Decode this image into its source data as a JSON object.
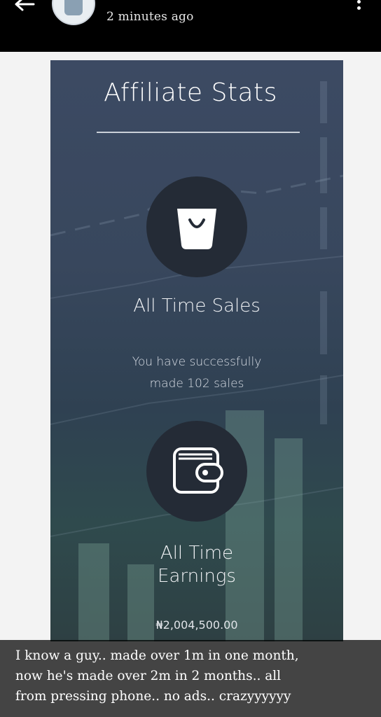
{
  "header": {
    "timestamp": "2 minutes ago",
    "icons": {
      "back": "back-arrow-icon",
      "menu": "more-vertical-icon"
    }
  },
  "card": {
    "title": "Affiliate Stats",
    "sales": {
      "icon": "shopping-bag-icon",
      "label": "All Time Sales",
      "description_line1": "You have successfully",
      "description_line2": "made 102 sales"
    },
    "earnings": {
      "icon": "wallet-icon",
      "label_line1": "All Time",
      "label_line2": "Earnings",
      "amount": "₦2,004,500.00"
    }
  },
  "caption": {
    "line1": "I know a guy.. made over 1m in one month,",
    "line2": "now he's made over 2m in 2 months.. all",
    "line3": "from pressing phone.. no ads.. crazyyyyyy"
  },
  "colors": {
    "card_top": "#3c4a63",
    "card_bottom": "#2e4043",
    "icon_circle": "#242b36",
    "text": "#ffffff"
  }
}
